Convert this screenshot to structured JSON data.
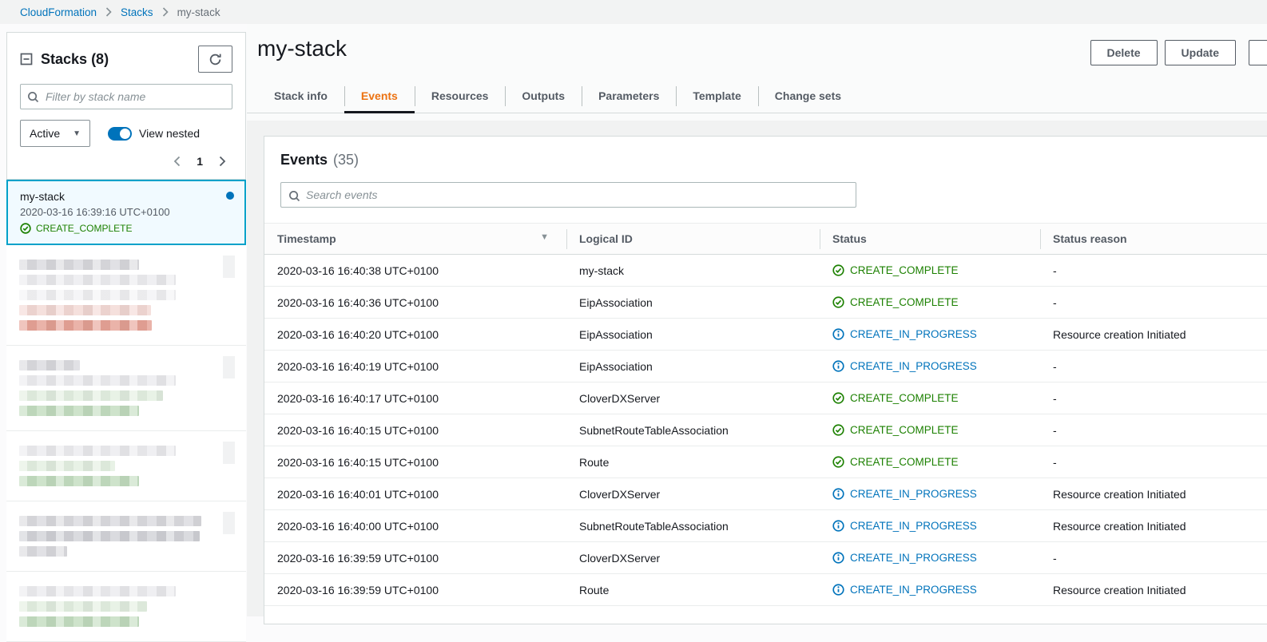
{
  "breadcrumb": {
    "items": [
      "CloudFormation",
      "Stacks",
      "my-stack"
    ]
  },
  "sidebar": {
    "title": "Stacks",
    "count": "(8)",
    "filter_placeholder": "Filter by stack name",
    "status_filter_value": "Active",
    "view_nested_label": "View nested",
    "page": "1",
    "selected_stack": {
      "name": "my-stack",
      "timestamp": "2020-03-16 16:39:16 UTC+0100",
      "status": "CREATE_COMPLETE"
    },
    "blurred_cards": [
      {
        "radio": true,
        "lines": [
          [
            "name",
            150
          ],
          [
            "time",
            196
          ],
          [
            "faint",
            196
          ],
          [
            "pink",
            165
          ],
          [
            "red",
            166
          ]
        ]
      },
      {
        "radio": true,
        "lines": [
          [
            "name",
            76
          ],
          [
            "time",
            196
          ],
          [
            "faintgreen",
            180
          ],
          [
            "green",
            150
          ]
        ]
      },
      {
        "radio": true,
        "lines": [
          [
            "time",
            196
          ],
          [
            "faintgreen",
            120
          ],
          [
            "green",
            150
          ]
        ]
      },
      {
        "radio": true,
        "lines": [
          [
            "name",
            228
          ],
          [
            "dark",
            226
          ],
          [
            "name",
            60
          ]
        ]
      },
      {
        "radio": false,
        "lines": [
          [
            "time",
            196
          ],
          [
            "faintgreen",
            160
          ],
          [
            "green",
            150
          ]
        ]
      }
    ]
  },
  "header": {
    "title": "my-stack",
    "delete_label": "Delete",
    "update_label": "Update"
  },
  "tabs": [
    {
      "label": "Stack info",
      "active": false
    },
    {
      "label": "Events",
      "active": true
    },
    {
      "label": "Resources",
      "active": false
    },
    {
      "label": "Outputs",
      "active": false
    },
    {
      "label": "Parameters",
      "active": false
    },
    {
      "label": "Template",
      "active": false
    },
    {
      "label": "Change sets",
      "active": false
    }
  ],
  "events": {
    "title": "Events",
    "count": "(35)",
    "search_placeholder": "Search events",
    "columns": [
      "Timestamp",
      "Logical ID",
      "Status",
      "Status reason"
    ],
    "rows": [
      {
        "timestamp": "2020-03-16 16:40:38 UTC+0100",
        "logical_id": "my-stack",
        "status": "CREATE_COMPLETE",
        "status_type": "complete",
        "reason": "-"
      },
      {
        "timestamp": "2020-03-16 16:40:36 UTC+0100",
        "logical_id": "EipAssociation",
        "status": "CREATE_COMPLETE",
        "status_type": "complete",
        "reason": "-"
      },
      {
        "timestamp": "2020-03-16 16:40:20 UTC+0100",
        "logical_id": "EipAssociation",
        "status": "CREATE_IN_PROGRESS",
        "status_type": "in_progress",
        "reason": "Resource creation Initiated"
      },
      {
        "timestamp": "2020-03-16 16:40:19 UTC+0100",
        "logical_id": "EipAssociation",
        "status": "CREATE_IN_PROGRESS",
        "status_type": "in_progress",
        "reason": "-"
      },
      {
        "timestamp": "2020-03-16 16:40:17 UTC+0100",
        "logical_id": "CloverDXServer",
        "status": "CREATE_COMPLETE",
        "status_type": "complete",
        "reason": "-"
      },
      {
        "timestamp": "2020-03-16 16:40:15 UTC+0100",
        "logical_id": "SubnetRouteTableAssociation",
        "status": "CREATE_COMPLETE",
        "status_type": "complete",
        "reason": "-"
      },
      {
        "timestamp": "2020-03-16 16:40:15 UTC+0100",
        "logical_id": "Route",
        "status": "CREATE_COMPLETE",
        "status_type": "complete",
        "reason": "-"
      },
      {
        "timestamp": "2020-03-16 16:40:01 UTC+0100",
        "logical_id": "CloverDXServer",
        "status": "CREATE_IN_PROGRESS",
        "status_type": "in_progress",
        "reason": "Resource creation Initiated"
      },
      {
        "timestamp": "2020-03-16 16:40:00 UTC+0100",
        "logical_id": "SubnetRouteTableAssociation",
        "status": "CREATE_IN_PROGRESS",
        "status_type": "in_progress",
        "reason": "Resource creation Initiated"
      },
      {
        "timestamp": "2020-03-16 16:39:59 UTC+0100",
        "logical_id": "CloverDXServer",
        "status": "CREATE_IN_PROGRESS",
        "status_type": "in_progress",
        "reason": "-"
      },
      {
        "timestamp": "2020-03-16 16:39:59 UTC+0100",
        "logical_id": "Route",
        "status": "CREATE_IN_PROGRESS",
        "status_type": "in_progress",
        "reason": "Resource creation Initiated"
      }
    ]
  },
  "icons": {
    "collapse": "square-minus",
    "refresh": "circular-arrow",
    "search": "magnifier",
    "caret": "▼",
    "sort": "▼",
    "prev": "chevron-left",
    "next": "chevron-right",
    "complete": "check-circle",
    "in_progress": "info-circle",
    "radio_selected": "filled-ring"
  },
  "colors": {
    "link_blue": "#0073bb",
    "accent_orange": "#ec7211",
    "success_green": "#1d8102",
    "info_blue": "#0073bb",
    "selected_border": "#00a1c9",
    "selected_bg": "#f1faff"
  }
}
